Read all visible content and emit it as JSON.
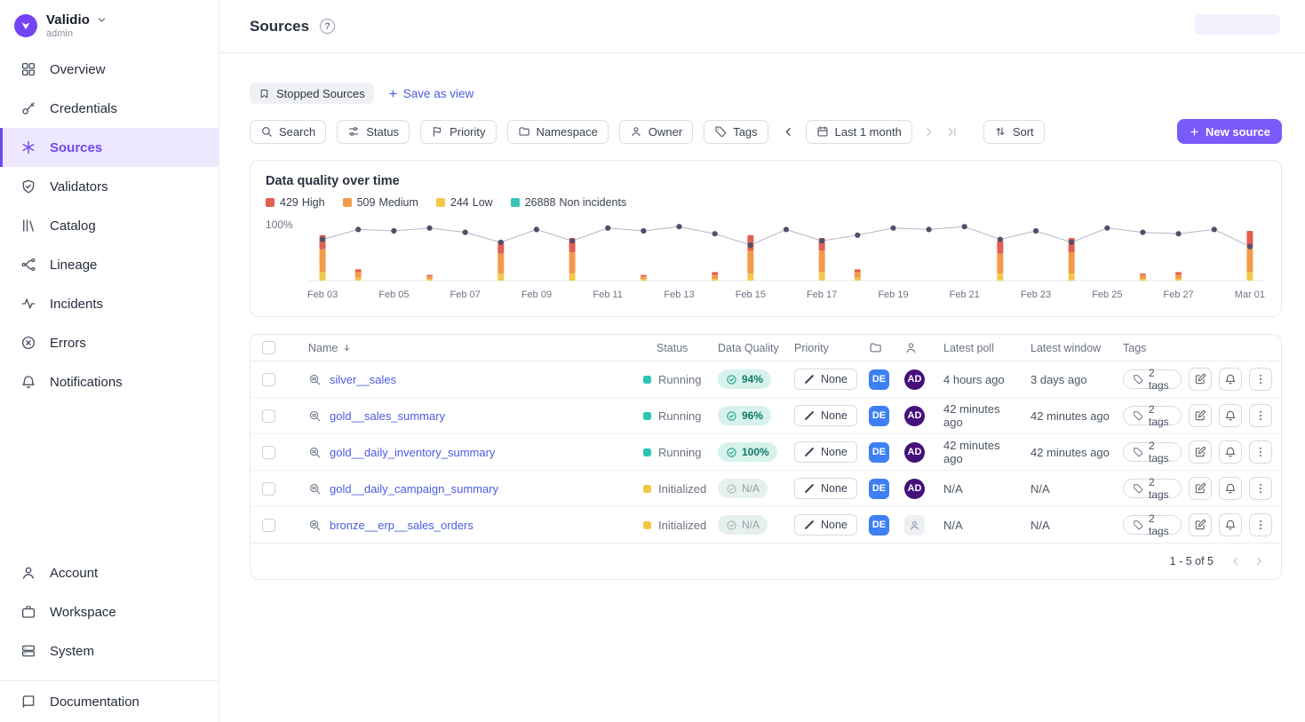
{
  "sidebar": {
    "brand": {
      "name": "Validio",
      "role": "admin"
    },
    "items": [
      {
        "label": "Overview"
      },
      {
        "label": "Credentials"
      },
      {
        "label": "Sources",
        "active": true
      },
      {
        "label": "Validators"
      },
      {
        "label": "Catalog"
      },
      {
        "label": "Lineage"
      },
      {
        "label": "Incidents"
      },
      {
        "label": "Errors"
      },
      {
        "label": "Notifications"
      }
    ],
    "bottom_items": [
      {
        "label": "Account"
      },
      {
        "label": "Workspace"
      },
      {
        "label": "System"
      }
    ],
    "documentation_label": "Documentation"
  },
  "header": {
    "title": "Sources",
    "help_label": "?"
  },
  "toolbar": {
    "view_chip_label": "Stopped Sources",
    "save_as_view_label": "Save as view",
    "filters": [
      {
        "label": "Search"
      },
      {
        "label": "Status"
      },
      {
        "label": "Priority"
      },
      {
        "label": "Namespace"
      },
      {
        "label": "Owner"
      },
      {
        "label": "Tags"
      }
    ],
    "date_range_label": "Last 1 month",
    "sort_label": "Sort",
    "new_source_label": "New source"
  },
  "chart": {
    "title": "Data quality over time",
    "y_top_label": "100%",
    "legend": [
      {
        "count": "429",
        "label": "High",
        "color": "#E2604F"
      },
      {
        "count": "509",
        "label": "Medium",
        "color": "#F29A4A"
      },
      {
        "count": "244",
        "label": "Low",
        "color": "#F2C84B"
      },
      {
        "count": "26888",
        "label": "Non incidents",
        "color": "#38C3B4"
      }
    ]
  },
  "chart_data": {
    "type": "line+bar",
    "x": [
      "Feb 03",
      "Feb 04",
      "Feb 05",
      "Feb 06",
      "Feb 07",
      "Feb 08",
      "Feb 09",
      "Feb 10",
      "Feb 11",
      "Feb 12",
      "Feb 13",
      "Feb 14",
      "Feb 15",
      "Feb 16",
      "Feb 17",
      "Feb 18",
      "Feb 19",
      "Feb 20",
      "Feb 21",
      "Feb 22",
      "Feb 23",
      "Feb 24",
      "Feb 25",
      "Feb 26",
      "Feb 27",
      "Feb 28",
      "Mar 01"
    ],
    "tick_labels": [
      "Feb 03",
      "Feb 05",
      "Feb 07",
      "Feb 09",
      "Feb 11",
      "Feb 13",
      "Feb 15",
      "Feb 17",
      "Feb 19",
      "Feb 21",
      "Feb 23",
      "Feb 25",
      "Feb 27",
      "Mar 01"
    ],
    "line_series": {
      "name": "Data quality %",
      "ylim": [
        95,
        100
      ],
      "values": [
        98.9,
        99.6,
        99.5,
        99.7,
        99.4,
        98.7,
        99.6,
        98.8,
        99.7,
        99.5,
        99.8,
        99.3,
        98.5,
        99.6,
        98.8,
        99.2,
        99.7,
        99.6,
        99.8,
        98.9,
        99.5,
        98.7,
        99.7,
        99.4,
        99.3,
        99.6,
        98.4
      ]
    },
    "bar_series": [
      {
        "name": "High",
        "color": "#E2604F",
        "values": [
          10,
          2,
          0,
          1,
          0,
          9,
          0,
          10,
          0,
          1,
          0,
          2,
          11,
          0,
          9,
          2,
          0,
          0,
          0,
          9,
          0,
          10,
          0,
          1,
          2,
          0,
          12
        ]
      },
      {
        "name": "Medium",
        "color": "#F29A4A",
        "values": [
          16,
          4,
          0,
          2,
          0,
          14,
          0,
          15,
          0,
          2,
          0,
          3,
          16,
          0,
          15,
          4,
          0,
          0,
          0,
          14,
          0,
          15,
          0,
          3,
          3,
          0,
          17
        ]
      },
      {
        "name": "Low",
        "color": "#F2C84B",
        "values": [
          6,
          2,
          0,
          1,
          0,
          5,
          0,
          5,
          0,
          1,
          0,
          1,
          5,
          0,
          6,
          2,
          0,
          0,
          0,
          5,
          0,
          5,
          0,
          1,
          1,
          0,
          6
        ]
      }
    ]
  },
  "table": {
    "headers": {
      "name": "Name",
      "status": "Status",
      "quality": "Data Quality",
      "priority": "Priority",
      "latest_poll": "Latest poll",
      "latest_window": "Latest window",
      "tags": "Tags"
    },
    "rows": [
      {
        "name": "silver__sales",
        "status": "Running",
        "quality": "94%",
        "priority": "None",
        "namespace": "DE",
        "owner": "AD",
        "latest_poll": "4 hours ago",
        "latest_window": "3 days ago",
        "tags": "2 tags"
      },
      {
        "name": "gold__sales_summary",
        "status": "Running",
        "quality": "96%",
        "priority": "None",
        "namespace": "DE",
        "owner": "AD",
        "latest_poll": "42 minutes ago",
        "latest_window": "42 minutes ago",
        "tags": "2 tags"
      },
      {
        "name": "gold__daily_inventory_summary",
        "status": "Running",
        "quality": "100%",
        "priority": "None",
        "namespace": "DE",
        "owner": "AD",
        "latest_poll": "42 minutes ago",
        "latest_window": "42 minutes ago",
        "tags": "2 tags"
      },
      {
        "name": "gold__daily_campaign_summary",
        "status": "Initialized",
        "quality": "N/A",
        "priority": "None",
        "namespace": "DE",
        "owner": "AD",
        "latest_poll": "N/A",
        "latest_window": "N/A",
        "tags": "2 tags"
      },
      {
        "name": "bronze__erp__sales_orders",
        "status": "Initialized",
        "quality": "N/A",
        "priority": "None",
        "namespace": "DE",
        "owner": null,
        "latest_poll": "N/A",
        "latest_window": "N/A",
        "tags": "2 tags"
      }
    ],
    "footer": {
      "range_label": "1 - 5 of 5"
    }
  },
  "colors": {
    "accent": "#7A5AF8",
    "active_nav": "#6D49F0",
    "running": "#2CC5B2",
    "initialized": "#F2C744",
    "link": "#4C5BE0"
  }
}
